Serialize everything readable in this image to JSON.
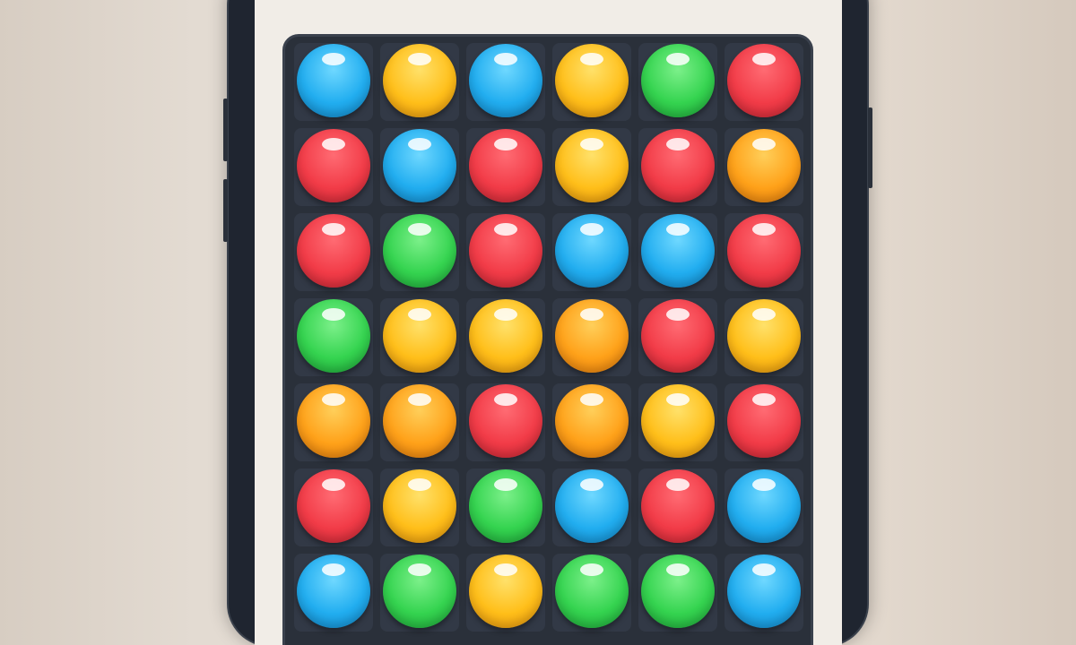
{
  "game": {
    "rows": 7,
    "columns": 6,
    "board": [
      [
        "blue",
        "yellow",
        "blue",
        "yellow",
        "green",
        "red"
      ],
      [
        "red",
        "blue",
        "red",
        "yellow",
        "red",
        "orange"
      ],
      [
        "red",
        "green",
        "red",
        "blue",
        "blue",
        "red"
      ],
      [
        "green",
        "yellow",
        "yellow",
        "orange",
        "red",
        "yellow"
      ],
      [
        "orange",
        "orange",
        "red",
        "orange",
        "yellow",
        "red"
      ],
      [
        "red",
        "yellow",
        "green",
        "blue",
        "red",
        "blue"
      ],
      [
        "blue",
        "green",
        "yellow",
        "green",
        "green",
        "blue"
      ]
    ]
  },
  "colors": {
    "red": "#f23c48",
    "blue": "#22aef0",
    "yellow": "#ffbf1a",
    "orange": "#ffa21a",
    "green": "#35d450",
    "board_background": "#2a303a",
    "screen_background": "#f1ede7"
  },
  "header": {
    "logo_icon": "circular-logo-icon"
  }
}
